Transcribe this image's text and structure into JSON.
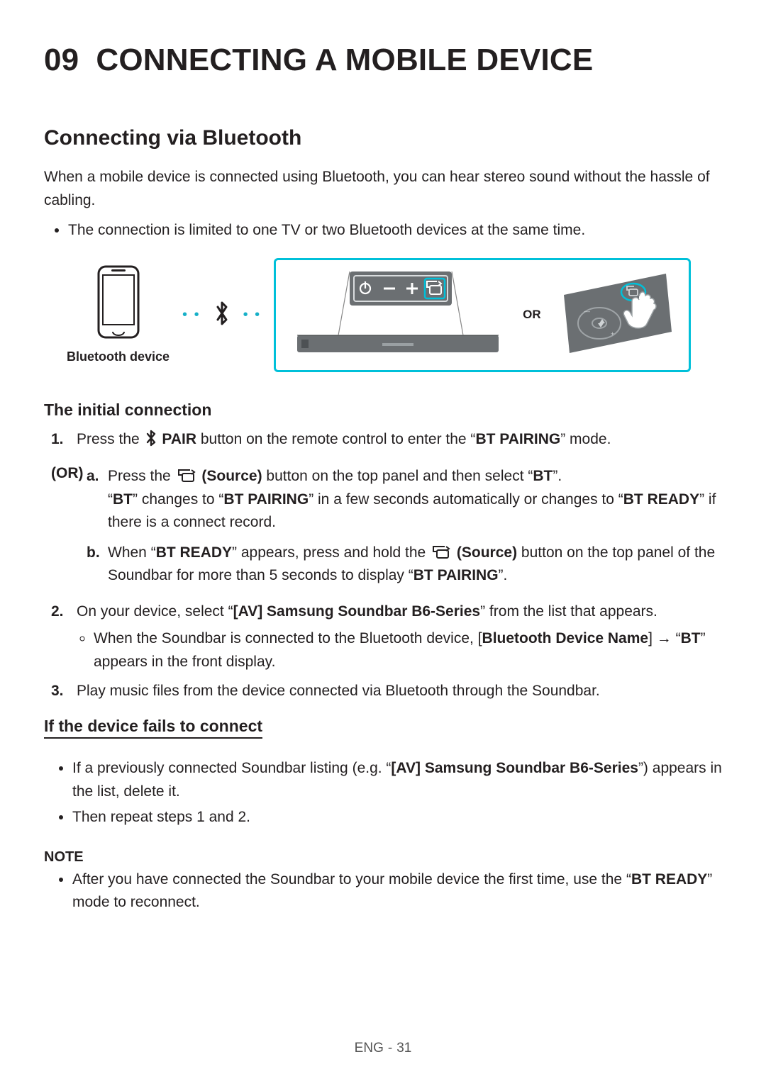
{
  "chapter": {
    "number": "09",
    "title": "CONNECTING A MOBILE DEVICE"
  },
  "section": {
    "title": "Connecting via Bluetooth"
  },
  "intro": "When a mobile device is connected using Bluetooth, you can hear stereo sound without the hassle of cabling.",
  "introBullet": "The connection is limited to one TV or two Bluetooth devices at the same time.",
  "figure": {
    "phoneCaption": "Bluetooth device",
    "or": "OR"
  },
  "subInitial": "The initial connection",
  "step1": {
    "num": "1.",
    "preText": "Press the ",
    "pairLabel": "PAIR",
    "midText": " button on the remote control to enter the “",
    "btPairing": "BT PAIRING",
    "postText": "” mode."
  },
  "orLabel": "(OR)",
  "subA": {
    "lab": "a.",
    "line1_pre": "Press the ",
    "sourceLabel": "(Source)",
    "line1_post": " button on the top panel and then select “",
    "bt": "BT",
    "line1_end": "”.",
    "line2_part1": "“",
    "line2_bt": "BT",
    "line2_mid": "” changes to “",
    "line2_btpair": "BT PAIRING",
    "line2_mid2": "” in a few seconds automatically or changes to “",
    "line2_btready": "BT READY",
    "line2_end": "” if there is a connect record."
  },
  "subB": {
    "lab": "b.",
    "pre": "When “",
    "btready": "BT READY",
    "mid": "” appears, press and hold the ",
    "sourceLabel": "(Source)",
    "mid2": " button on the top panel of the Soundbar for more than 5 seconds to display “",
    "btpair": "BT PAIRING",
    "end": "”."
  },
  "step2": {
    "num": "2.",
    "pre": "On your device, select “",
    "device": "[AV] Samsung Soundbar B6-Series",
    "post": "” from the list that appears.",
    "bullet_pre": "When the Soundbar is connected to the Bluetooth device, [",
    "bullet_name": "Bluetooth Device Name",
    "bullet_mid": "] → “",
    "bullet_bt": "BT",
    "bullet_end": "” appears in the front display."
  },
  "step3": {
    "num": "3.",
    "text": "Play music files from the device connected via Bluetooth through the Soundbar."
  },
  "subFails": "If the device fails to connect",
  "fails": {
    "b1_pre": "If a previously connected Soundbar listing (e.g. “",
    "b1_dev": "[AV] Samsung Soundbar B6-Series",
    "b1_post": "”) appears in the list, delete it.",
    "b2": "Then repeat steps 1 and 2."
  },
  "noteHead": "NOTE",
  "note": {
    "pre": "After you have connected the Soundbar to your mobile device the first time, use the “",
    "btready": "BT READY",
    "post": "” mode to reconnect."
  },
  "footer": {
    "lang": "ENG",
    "page": "31"
  }
}
